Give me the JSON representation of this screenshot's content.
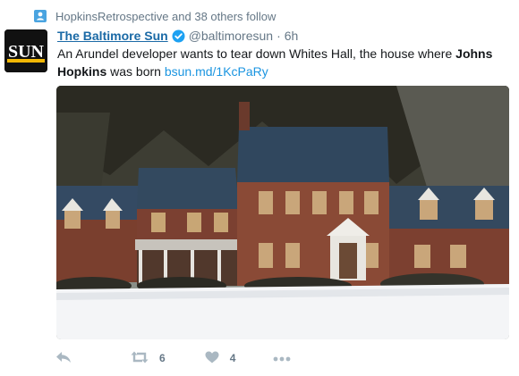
{
  "context": {
    "icon": "follow-icon",
    "text": "HopkinsRetrospective and 38 others follow"
  },
  "tweet": {
    "avatar": {
      "logo_text": "SUN",
      "background": "#111111",
      "accent": "#f2b705"
    },
    "fullname": "The Baltimore Sun",
    "verified_icon": "verified-badge-icon",
    "handle": "@baltimoresun",
    "separator": "·",
    "time": "6h",
    "text_parts": {
      "before": "An Arundel developer wants to tear down Whites Hall, the house where ",
      "bold": "Johns Hopkins",
      "after": " was born ",
      "link": "bsun.md/1KcPaRy"
    },
    "media_description_icon": "photo"
  },
  "actions": {
    "reply_icon": "reply-icon",
    "retweet_icon": "retweet-icon",
    "retweet_count": "6",
    "like_icon": "heart-icon",
    "like_count": "4",
    "more_icon": "more-icon"
  },
  "colors": {
    "name_blue": "#1b6aa6",
    "link_blue": "#1b95e0",
    "muted": "#657786",
    "action_gray": "#aab8c2"
  }
}
